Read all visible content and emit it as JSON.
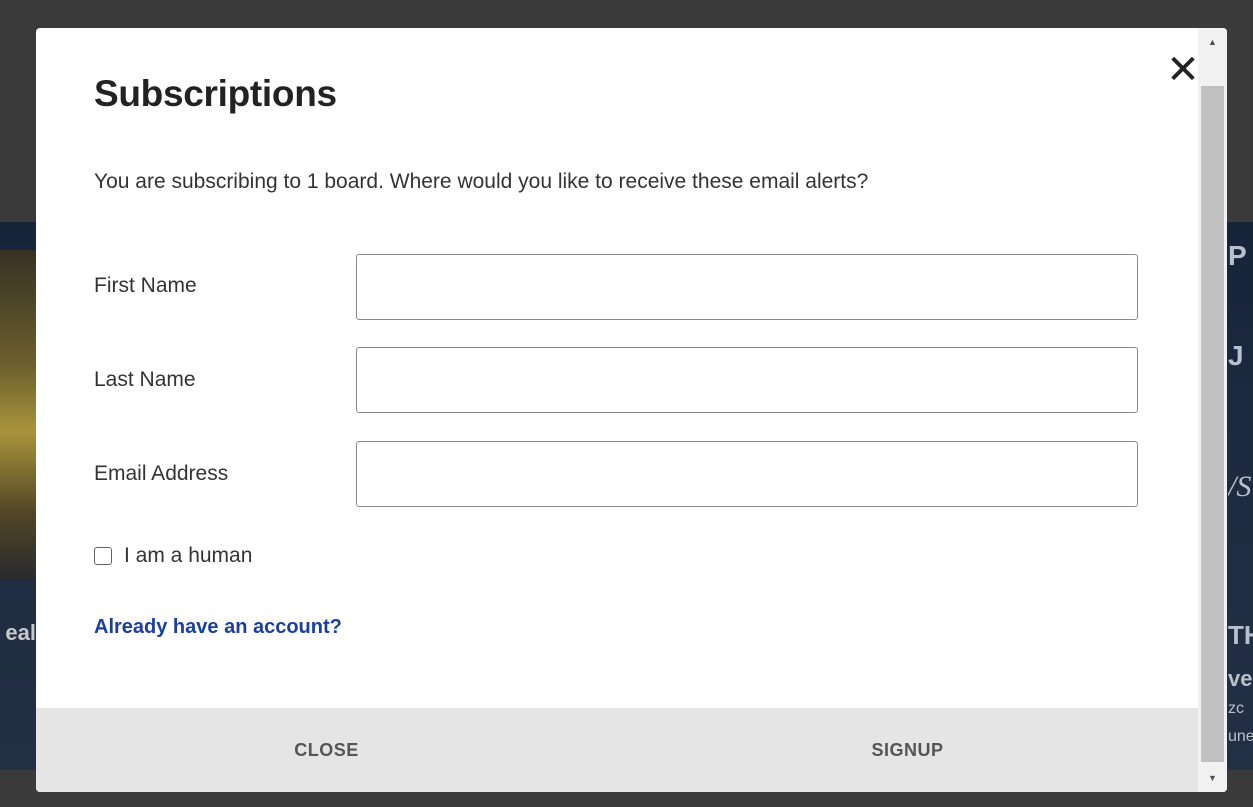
{
  "modal": {
    "title": "Subscriptions",
    "close_glyph": "✕",
    "close_icon": "close-icon",
    "intro": "You are subscribing to 1 board. Where would you like to receive these email alerts?",
    "fields": [
      {
        "label": "First Name",
        "value": "",
        "placeholder": ""
      },
      {
        "label": "Last Name",
        "value": "",
        "placeholder": ""
      },
      {
        "label": "Email Address",
        "value": "",
        "placeholder": ""
      }
    ],
    "checkbox": {
      "label": "I am a human",
      "checked": false
    },
    "account_link": "Already have an account?",
    "footer": {
      "close_label": "CLOSE",
      "signup_label": "SIGNUP"
    }
  },
  "scrollbar": {
    "up_glyph": "▲",
    "down_glyph": "▼"
  },
  "background_fragments": {
    "left": "eal",
    "right": [
      "P",
      "J",
      "/S",
      "TH",
      "ve",
      "zc",
      "une"
    ]
  },
  "colors": {
    "link": "#1a3fa0",
    "footer_bg": "#e5e5e5",
    "backdrop": "#3a3a3a"
  }
}
